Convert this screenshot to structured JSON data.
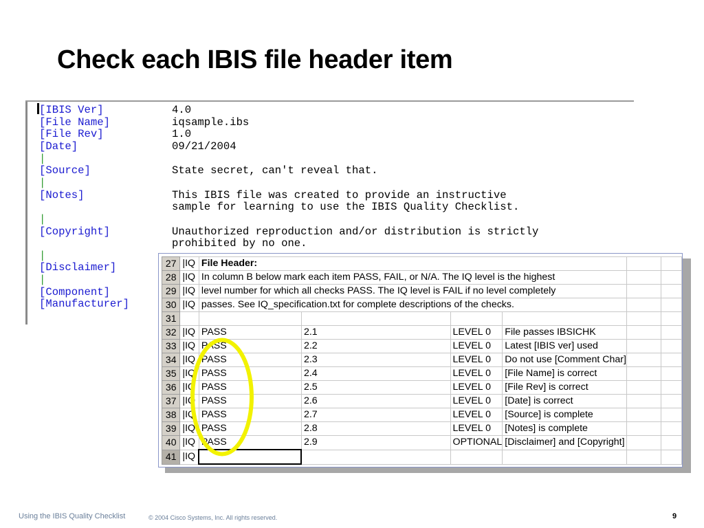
{
  "slide": {
    "title": "Check each IBIS file header item"
  },
  "editor": {
    "lines": [
      {
        "type": "kv",
        "key": "[IBIS Ver]",
        "value": "4.0"
      },
      {
        "type": "kv",
        "key": "[File Name]",
        "value": "iqsample.ibs"
      },
      {
        "type": "kv",
        "key": "[File Rev]",
        "value": "1.0"
      },
      {
        "type": "kv",
        "key": "[Date]",
        "value": "09/21/2004"
      },
      {
        "type": "bar",
        "key": "|",
        "value": ""
      },
      {
        "type": "kv",
        "key": "[Source]",
        "value": "State secret, can't reveal that."
      },
      {
        "type": "bar",
        "key": "|",
        "value": ""
      },
      {
        "type": "kv",
        "key": "[Notes]",
        "value": "This IBIS file was created to provide an instructive"
      },
      {
        "type": "cont",
        "key": "",
        "value": "sample for learning to use the IBIS Quality Checklist."
      },
      {
        "type": "bar",
        "key": "|",
        "value": ""
      },
      {
        "type": "kv",
        "key": "[Copyright]",
        "value": "Unauthorized reproduction and/or distribution is strictly"
      },
      {
        "type": "cont",
        "key": "",
        "value": "prohibited by no one."
      },
      {
        "type": "bar",
        "key": "|",
        "value": ""
      },
      {
        "type": "kv",
        "key": "[Disclaimer]",
        "value": ""
      },
      {
        "type": "bar",
        "key": "|",
        "value": ""
      },
      {
        "type": "kv",
        "key": "[Component]",
        "value": ""
      },
      {
        "type": "kv",
        "key": "[Manufacturer]",
        "value": ""
      }
    ]
  },
  "spreadsheet": {
    "rows": [
      {
        "num": "27",
        "b": "|IQ",
        "c": "File Header:",
        "d": "",
        "e": "",
        "f": "",
        "kind": "header"
      },
      {
        "num": "28",
        "b": "|IQ",
        "c": "In column B below mark each item PASS, FAIL, or N/A. The IQ level is the highest",
        "d": "",
        "e": "",
        "f": "",
        "kind": "note"
      },
      {
        "num": "29",
        "b": "|IQ",
        "c": "level number for which all checks PASS. The IQ level is FAIL if no level completely",
        "d": "",
        "e": "",
        "f": "",
        "kind": "note"
      },
      {
        "num": "30",
        "b": "|IQ",
        "c": "passes. See IQ_specification.txt for complete descriptions of the checks.",
        "d": "",
        "e": "",
        "f": "",
        "kind": "note"
      },
      {
        "num": "31",
        "b": "",
        "c": "",
        "d": "",
        "e": "",
        "f": "",
        "kind": "blank"
      },
      {
        "num": "32",
        "b": "|IQ",
        "c": "PASS",
        "d": "2.1",
        "e": "LEVEL 0",
        "f": "File passes IBSICHK",
        "kind": "check"
      },
      {
        "num": "33",
        "b": "|IQ",
        "c": "PASS",
        "d": "2.2",
        "e": "LEVEL 0",
        "f": "Latest [IBIS ver] used",
        "kind": "check"
      },
      {
        "num": "34",
        "b": "|IQ",
        "c": "PASS",
        "d": "2.3",
        "e": "LEVEL 0",
        "f": "Do not use [Comment Char]",
        "kind": "check"
      },
      {
        "num": "35",
        "b": "|IQ",
        "c": "PASS",
        "d": "2.4",
        "e": "LEVEL 0",
        "f": "[File Name] is correct",
        "kind": "check"
      },
      {
        "num": "36",
        "b": "|IQ",
        "c": "PASS",
        "d": "2.5",
        "e": "LEVEL 0",
        "f": "[File Rev] is correct",
        "kind": "check"
      },
      {
        "num": "37",
        "b": "|IQ",
        "c": "PASS",
        "d": "2.6",
        "e": "LEVEL 0",
        "f": "[Date] is correct",
        "kind": "check"
      },
      {
        "num": "38",
        "b": "|IQ",
        "c": "PASS",
        "d": "2.7",
        "e": "LEVEL 0",
        "f": "[Source] is complete",
        "kind": "check"
      },
      {
        "num": "39",
        "b": "|IQ",
        "c": "PASS",
        "d": "2.8",
        "e": "LEVEL 0",
        "f": "[Notes] is complete",
        "kind": "check"
      },
      {
        "num": "40",
        "b": "|IQ",
        "c": "PASS",
        "d": "2.9",
        "e": "OPTIONAL",
        "f": "[Disclaimer] and [Copyright]",
        "kind": "check"
      },
      {
        "num": "41",
        "b": "|IQ",
        "c": "",
        "d": "",
        "e": "",
        "f": "",
        "kind": "active"
      }
    ]
  },
  "highlight": {
    "color": "#f2f200"
  },
  "footer": {
    "left": "Using the IBIS Quality Checklist",
    "copyright": "© 2004 Cisco Systems, Inc. All rights reserved.",
    "page": "9"
  }
}
